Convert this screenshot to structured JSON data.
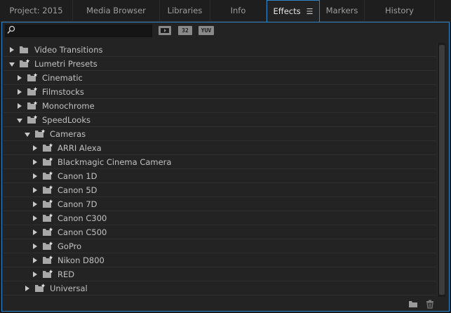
{
  "tabs": [
    {
      "label": "Project: 2015",
      "active": false
    },
    {
      "label": "Media Browser",
      "active": false
    },
    {
      "label": "Libraries",
      "active": false
    },
    {
      "label": "Info",
      "active": false
    },
    {
      "label": "Effects",
      "active": true
    },
    {
      "label": "Markers",
      "active": false
    },
    {
      "label": "History",
      "active": false
    }
  ],
  "toolbar": {
    "search_placeholder": "",
    "accelerated_label": "",
    "bit32_label": "32",
    "yuv_label": "YUV"
  },
  "tree": [
    {
      "label": "Video Transitions",
      "depth": 0,
      "expanded": false,
      "preset": false
    },
    {
      "label": "Lumetri Presets",
      "depth": 0,
      "expanded": true,
      "preset": true
    },
    {
      "label": "Cinematic",
      "depth": 1,
      "expanded": false,
      "preset": true
    },
    {
      "label": "Filmstocks",
      "depth": 1,
      "expanded": false,
      "preset": true
    },
    {
      "label": "Monochrome",
      "depth": 1,
      "expanded": false,
      "preset": true
    },
    {
      "label": "SpeedLooks",
      "depth": 1,
      "expanded": true,
      "preset": true
    },
    {
      "label": "Cameras",
      "depth": 2,
      "expanded": true,
      "preset": true
    },
    {
      "label": "ARRI Alexa",
      "depth": 3,
      "expanded": false,
      "preset": true
    },
    {
      "label": "Blackmagic Cinema Camera",
      "depth": 3,
      "expanded": false,
      "preset": true
    },
    {
      "label": "Canon 1D",
      "depth": 3,
      "expanded": false,
      "preset": true
    },
    {
      "label": "Canon 5D",
      "depth": 3,
      "expanded": false,
      "preset": true
    },
    {
      "label": "Canon 7D",
      "depth": 3,
      "expanded": false,
      "preset": true
    },
    {
      "label": "Canon C300",
      "depth": 3,
      "expanded": false,
      "preset": true
    },
    {
      "label": "Canon C500",
      "depth": 3,
      "expanded": false,
      "preset": true
    },
    {
      "label": "GoPro",
      "depth": 3,
      "expanded": false,
      "preset": true
    },
    {
      "label": "Nikon D800",
      "depth": 3,
      "expanded": false,
      "preset": true
    },
    {
      "label": "RED",
      "depth": 3,
      "expanded": false,
      "preset": true
    },
    {
      "label": "Universal",
      "depth": 2,
      "expanded": false,
      "preset": true
    }
  ],
  "icons": {
    "search": "search-icon",
    "panel_menu": "panel-menu-icon",
    "new_bin": "new-bin-icon",
    "delete": "trash-icon"
  },
  "colors": {
    "accent": "#2e86c9",
    "background": "#232323"
  }
}
